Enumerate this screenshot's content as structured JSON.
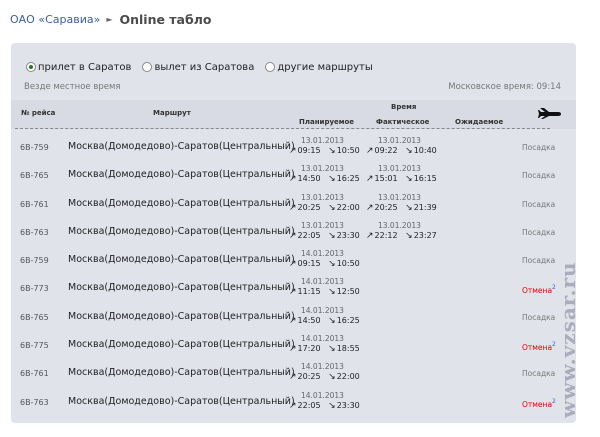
{
  "breadcrumb": {
    "link": "ОАО «Саравиа»",
    "current": "Online табло"
  },
  "filters": {
    "options": [
      {
        "label": "прилет в Саратов",
        "checked": true
      },
      {
        "label": "вылет из Саратова",
        "checked": false
      },
      {
        "label": "другие маршруты",
        "checked": false
      }
    ]
  },
  "notes": {
    "local_time": "Везде местное время",
    "moscow_label": "Московское время:",
    "moscow_time": "09:14"
  },
  "table_head": {
    "flight": "№ рейса",
    "route": "Маршрут",
    "time": "Время",
    "planned": "Планируемое",
    "actual": "Фактическое",
    "expected": "Ожидаемое",
    "icon": "plane-landing-icon"
  },
  "flights": [
    {
      "flight": "6В-759",
      "route": "Москва(Домодедово)-Саратов(Центральный)",
      "planned": {
        "date": "13.01.2013",
        "dep": "09:15",
        "arr": "10:50"
      },
      "actual": {
        "date": "13.01.2013",
        "dep": "09:22",
        "arr": "10:40"
      },
      "status": "Посадка",
      "status_type": "boarding",
      "note": ""
    },
    {
      "flight": "6В-765",
      "route": "Москва(Домодедово)-Саратов(Центральный)",
      "planned": {
        "date": "13.01.2013",
        "dep": "14:50",
        "arr": "16:25"
      },
      "actual": {
        "date": "13.01.2013",
        "dep": "15:01",
        "arr": "16:15"
      },
      "status": "Посадка",
      "status_type": "boarding",
      "note": ""
    },
    {
      "flight": "6В-761",
      "route": "Москва(Домодедово)-Саратов(Центральный)",
      "planned": {
        "date": "13.01.2013",
        "dep": "20:25",
        "arr": "22:00"
      },
      "actual": {
        "date": "13.01.2013",
        "dep": "20:25",
        "arr": "21:39"
      },
      "status": "Посадка",
      "status_type": "boarding",
      "note": ""
    },
    {
      "flight": "6В-763",
      "route": "Москва(Домодедово)-Саратов(Центральный)",
      "planned": {
        "date": "13.01.2013",
        "dep": "22:05",
        "arr": "23:30"
      },
      "actual": {
        "date": "13.01.2013",
        "dep": "22:12",
        "arr": "23:27"
      },
      "status": "Посадка",
      "status_type": "boarding",
      "note": ""
    },
    {
      "flight": "6В-759",
      "route": "Москва(Домодедово)-Саратов(Центральный)",
      "planned": {
        "date": "14.01.2013",
        "dep": "09:15",
        "arr": "10:50"
      },
      "actual": null,
      "status": "Посадка",
      "status_type": "boarding",
      "note": ""
    },
    {
      "flight": "6В-773",
      "route": "Москва(Домодедово)-Саратов(Центральный)",
      "planned": {
        "date": "14.01.2013",
        "dep": "11:15",
        "arr": "12:50"
      },
      "actual": null,
      "status": "Отмена",
      "status_type": "cancel",
      "note": "2"
    },
    {
      "flight": "6В-765",
      "route": "Москва(Домодедово)-Саратов(Центральный)",
      "planned": {
        "date": "14.01.2013",
        "dep": "14:50",
        "arr": "16:25"
      },
      "actual": null,
      "status": "Посадка",
      "status_type": "boarding",
      "note": ""
    },
    {
      "flight": "6В-775",
      "route": "Москва(Домодедово)-Саратов(Центральный)",
      "planned": {
        "date": "14.01.2013",
        "dep": "17:20",
        "arr": "18:55"
      },
      "actual": null,
      "status": "Отмена",
      "status_type": "cancel",
      "note": "2"
    },
    {
      "flight": "6В-761",
      "route": "Москва(Домодедово)-Саратов(Центральный)",
      "planned": {
        "date": "14.01.2013",
        "dep": "20:25",
        "arr": "22:00"
      },
      "actual": null,
      "status": "Посадка",
      "status_type": "boarding",
      "note": ""
    },
    {
      "flight": "6В-763",
      "route": "Москва(Домодедово)-Саратов(Центральный)",
      "planned": {
        "date": "14.01.2013",
        "dep": "22:05",
        "arr": "23:30"
      },
      "actual": null,
      "status": "Отмена",
      "status_type": "cancel",
      "note": "2"
    }
  ],
  "watermark": "www.vzsar.ru",
  "colors": {
    "panel": "#e1e3eb",
    "cancel": "#e00000",
    "link": "#3a5f9a"
  }
}
